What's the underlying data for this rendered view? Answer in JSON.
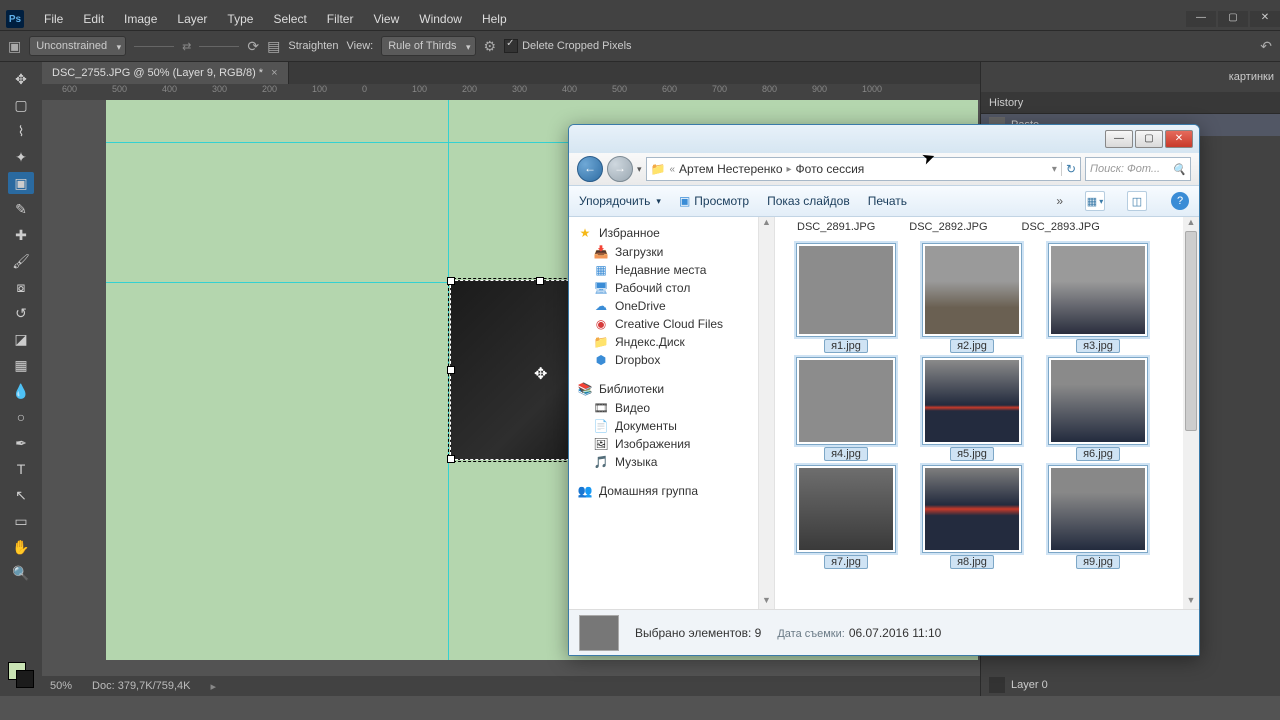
{
  "ps": {
    "logo": "Ps",
    "menu": [
      "File",
      "Edit",
      "Image",
      "Layer",
      "Type",
      "Select",
      "Filter",
      "View",
      "Window",
      "Help"
    ],
    "options": {
      "constraint": "Unconstrained",
      "straighten": "Straighten",
      "view_label": "View:",
      "overlay": "Rule of Thirds",
      "delete_cropped": "Delete Cropped Pixels"
    },
    "doc_tab": "DSC_2755.JPG @ 50% (Layer 9, RGB/8) *",
    "ruler_h": [
      "600",
      "500",
      "400",
      "300",
      "200",
      "100",
      "0",
      "100",
      "200",
      "300",
      "400",
      "500",
      "600",
      "700",
      "800",
      "900",
      "1000"
    ],
    "status": {
      "zoom": "50%",
      "doc": "Doc: 379,7K/759,4K"
    },
    "right": {
      "combo": "картинки",
      "history": "History",
      "paste": "Paste",
      "layer0": "Layer 0"
    }
  },
  "explorer": {
    "breadcrumb": {
      "sep": "«",
      "p1": "Артем Нестеренко",
      "p2": "Фото сессия"
    },
    "search_placeholder": "Поиск: Фот...",
    "toolbar": {
      "organize": "Упорядочить",
      "preview": "Просмотр",
      "slideshow": "Показ слайдов",
      "print": "Печать",
      "overflow": "»"
    },
    "sidebar": {
      "favorites": "Избранное",
      "fav_items": [
        "Загрузки",
        "Недавние места",
        "Рабочий стол",
        "OneDrive",
        "Creative Cloud Files",
        "Яндекс.Диск",
        "Dropbox"
      ],
      "libraries": "Библиотеки",
      "lib_items": [
        "Видео",
        "Документы",
        "Изображения",
        "Музыка"
      ],
      "homegroup": "Домашняя группа"
    },
    "file_headers": [
      "DSC_2891.JPG",
      "DSC_2892.JPG",
      "DSC_2893.JPG"
    ],
    "files": [
      "я1.jpg",
      "я2.jpg",
      "я3.jpg",
      "я4.jpg",
      "я5.jpg",
      "я6.jpg",
      "я7.jpg",
      "я8.jpg",
      "я9.jpg"
    ],
    "status": {
      "selected": "Выбрано элементов: 9",
      "date_label": "Дата съемки:",
      "date_value": "06.07.2016 11:10"
    }
  }
}
